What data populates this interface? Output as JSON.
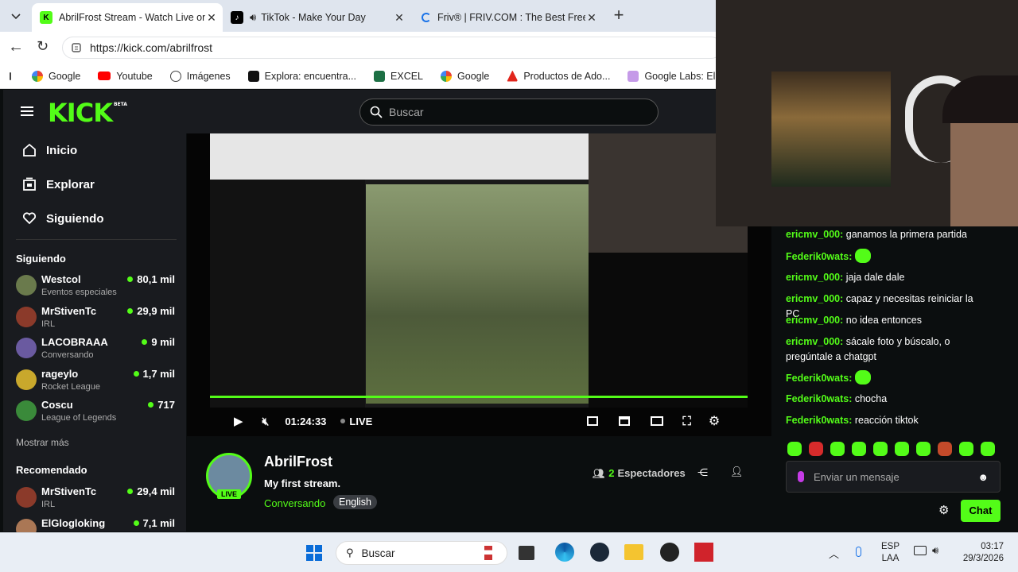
{
  "tabs": [
    {
      "title": "AbrilFrost Stream - Watch Live on",
      "icon": "kick-icon"
    },
    {
      "title": "TikTok - Make Your Day",
      "icon": "tiktok-icon"
    },
    {
      "title": "Friv® | FRIV.COM : The Best Free G",
      "icon": "loading-icon"
    }
  ],
  "address": {
    "url": "https://kick.com/abrilfrost"
  },
  "bookmarks": [
    "Google",
    "Youtube",
    "Imágenes",
    "Explora: encuentra...",
    "EXCEL",
    "Google",
    "Productos de Ado...",
    "Google Labs: El I"
  ],
  "kick": {
    "logo": "KICK",
    "logo_badge": "BETA",
    "search_placeholder": "Buscar",
    "nav": [
      "Inicio",
      "Explorar",
      "Siguiendo"
    ],
    "following_header": "Siguiendo",
    "following": [
      {
        "name": "Westcol",
        "game": "Eventos especiales",
        "viewers": "80,1 mil",
        "color": "#6a7a4c"
      },
      {
        "name": "MrStivenTc",
        "game": "IRL",
        "viewers": "29,9 mil",
        "color": "#8b3a2a"
      },
      {
        "name": "LACOBRAAA",
        "game": "Conversando",
        "viewers": "9 mil",
        "color": "#6a5aa0"
      },
      {
        "name": "rageylo",
        "game": "Rocket League",
        "viewers": "1,7 mil",
        "color": "#c9a82c"
      },
      {
        "name": "Coscu",
        "game": "League of Legends",
        "viewers": "717",
        "color": "#3a8a3a"
      }
    ],
    "show_more": "Mostrar más",
    "recommended_header": "Recomendado",
    "recommended": [
      {
        "name": "MrStivenTc",
        "game": "IRL",
        "viewers": "29,4 mil",
        "color": "#8b3a2a"
      },
      {
        "name": "ElGlogloking",
        "game": "",
        "viewers": "7,1 mil",
        "color": "#aa7755"
      }
    ],
    "player": {
      "time": "01:24:33",
      "live": "LIVE",
      "progress": 1.0
    },
    "streamer": {
      "name": "AbrilFrost",
      "title": "My first stream.",
      "category": "Conversando",
      "language": "English",
      "live_badge": "LIVE",
      "viewers_count": "2",
      "viewers_label": "Espectadores"
    },
    "chat": {
      "messages": [
        {
          "user": "ericmv_000",
          "text": "ganamos la primera partida",
          "color": "#53fc18",
          "emote": false
        },
        {
          "user": "Federik0wats",
          "text": "",
          "color": "#53fc18",
          "emote": true
        },
        {
          "user": "ericmv_000",
          "text": "jaja dale dale",
          "color": "#53fc18",
          "emote": false
        },
        {
          "user": "ericmv_000",
          "text": "capaz y necesitas reiniciar la PC",
          "color": "#53fc18",
          "emote": false
        },
        {
          "user": "ericmv_000",
          "text": "no idea entonces",
          "color": "#53fc18",
          "emote": false
        },
        {
          "user": "ericmv_000",
          "text": "sácale foto y búscalo, o pregúntale a chatgpt",
          "color": "#53fc18",
          "emote": false
        },
        {
          "user": "Federik0wats",
          "text": "",
          "color": "#53fc18",
          "emote": true
        },
        {
          "user": "Federik0wats",
          "text": "chocha",
          "color": "#53fc18",
          "emote": false
        },
        {
          "user": "Federik0wats",
          "text": "reacción tiktok",
          "color": "#53fc18",
          "emote": false
        }
      ],
      "input_placeholder": "Enviar un mensaje",
      "send_label": "Chat"
    }
  },
  "taskbar": {
    "search": "Buscar",
    "lang1": "ESP",
    "lang2": "LAA",
    "time": "03:17",
    "date": "29/3/2026"
  },
  "colors": {
    "accent": "#53fc18",
    "bg": "#0b0e0f",
    "panel": "#191b1f"
  }
}
